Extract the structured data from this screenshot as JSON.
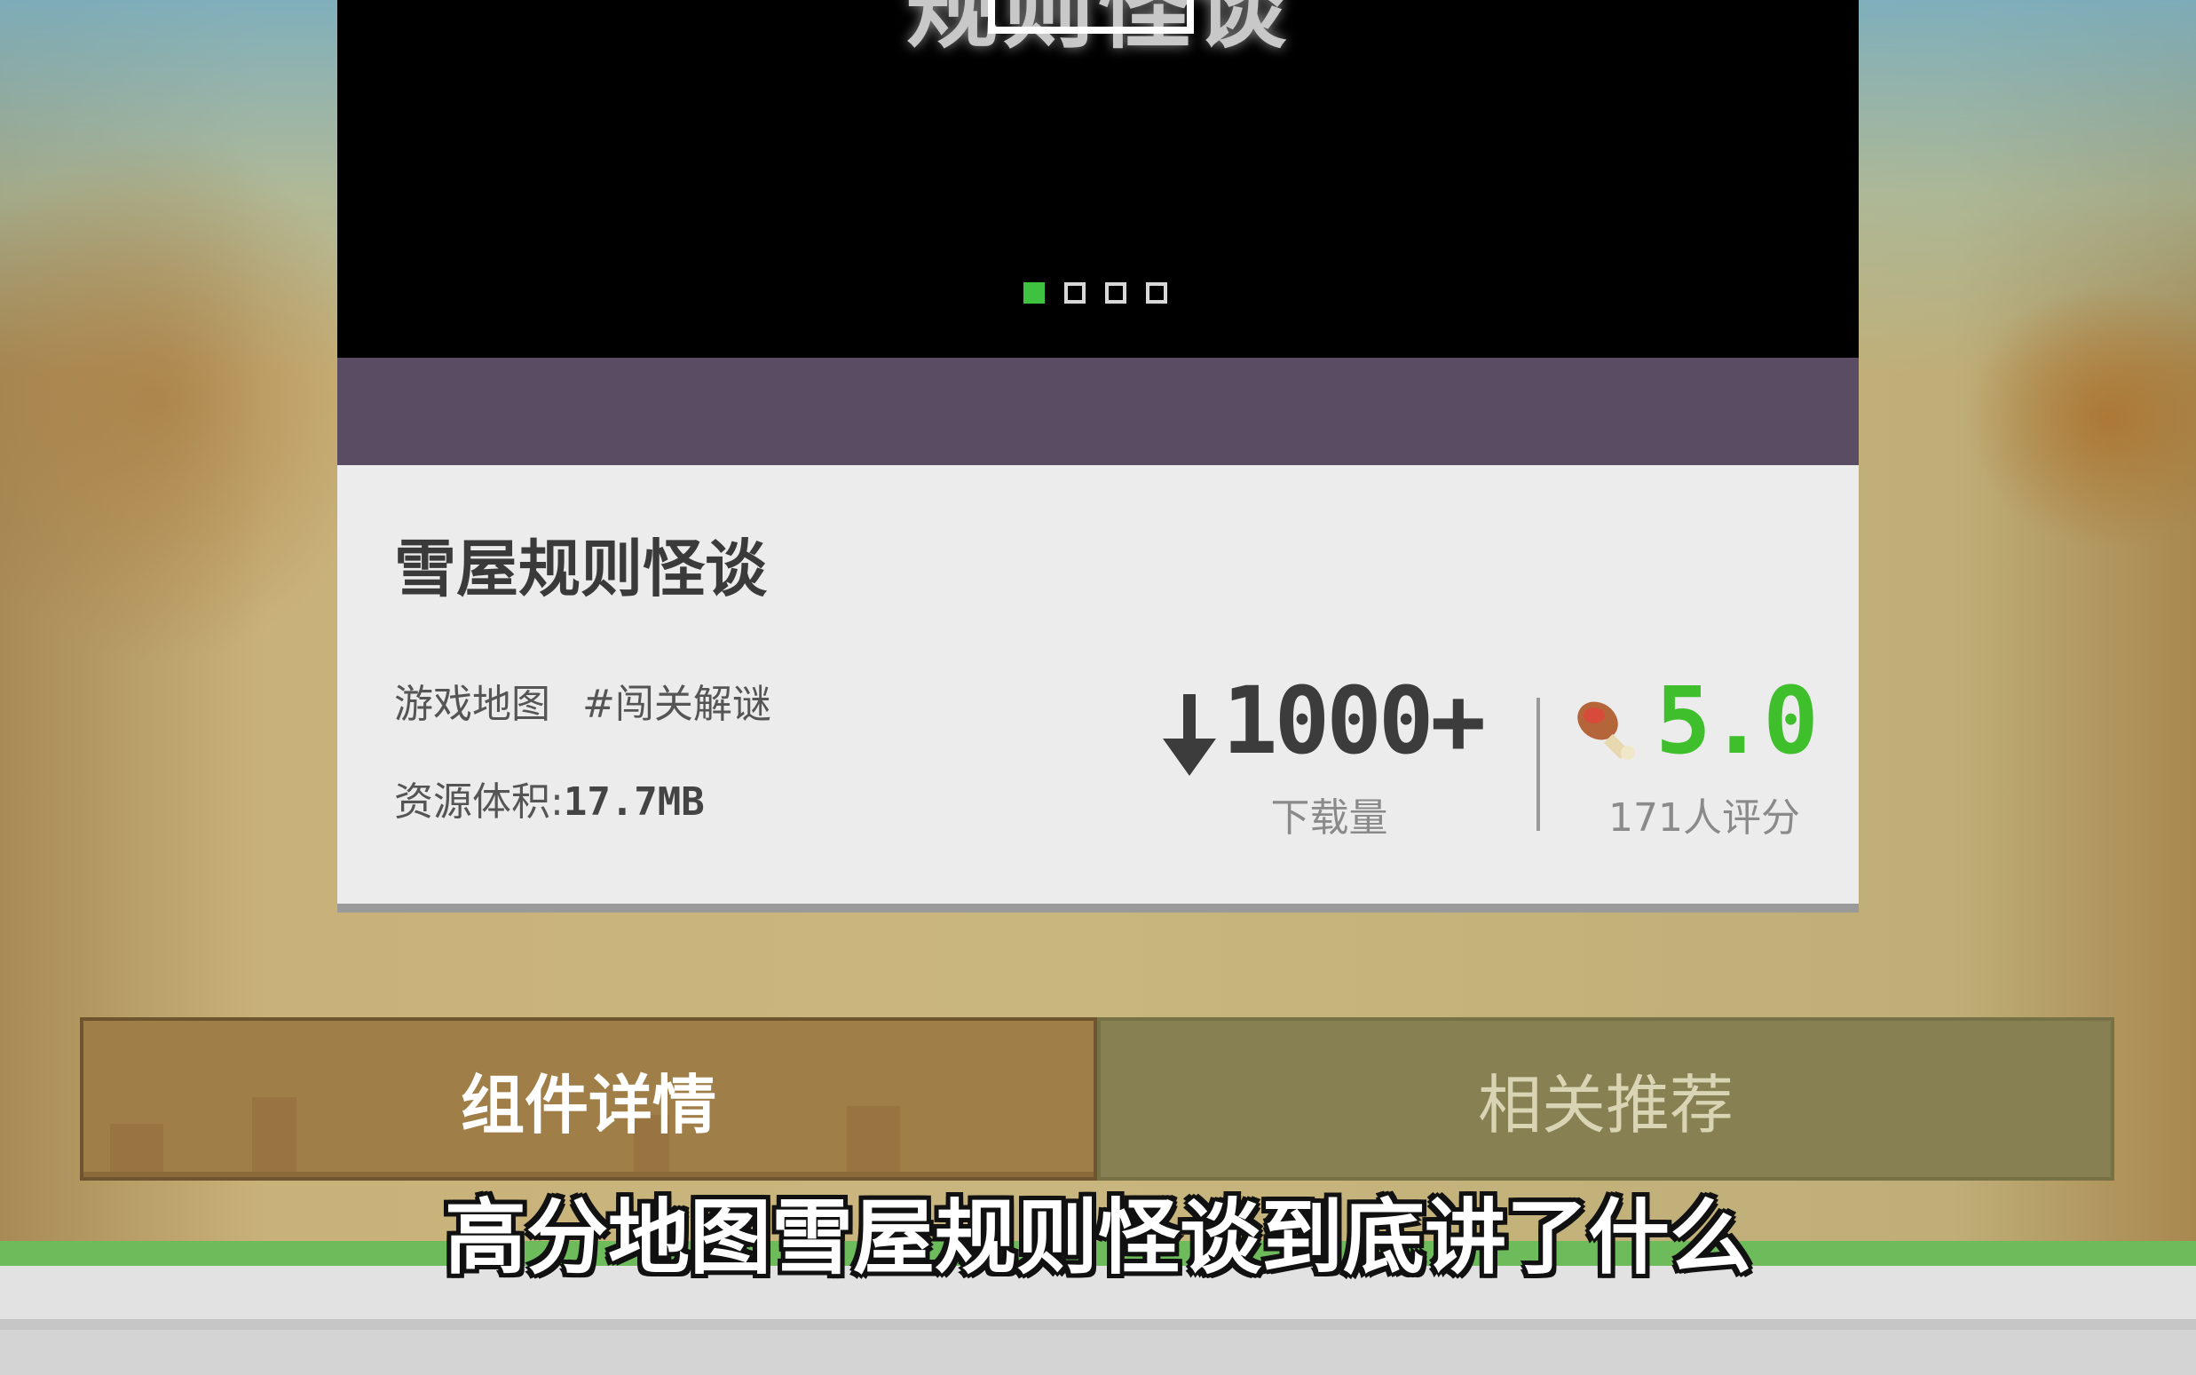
{
  "banner": {
    "title": "规则怪谈",
    "carousel_count": 4,
    "carousel_active_index": 0
  },
  "item": {
    "title": "雪屋规则怪谈",
    "tags": [
      "游戏地图",
      "#闯关解谜"
    ],
    "size_label": "资源体积:",
    "size_value": "17.7MB"
  },
  "stats": {
    "downloads": "1000+",
    "downloads_label": "下载量",
    "rating": "5.0",
    "rating_label": "171人评分",
    "download_icon": "download-arrow-icon",
    "rating_icon": "drumstick-icon"
  },
  "tabs": [
    {
      "label": "组件详情",
      "active": true
    },
    {
      "label": "相关推荐",
      "active": false
    }
  ],
  "subtitle": "高分地图雪屋规则怪谈到底讲了什么",
  "colors": {
    "rating_green": "#3fbf2c",
    "active_dot": "#3fc23f",
    "tab_active": "#a07e48",
    "tab_inactive": "#868052",
    "strip": "#5a4c62"
  }
}
